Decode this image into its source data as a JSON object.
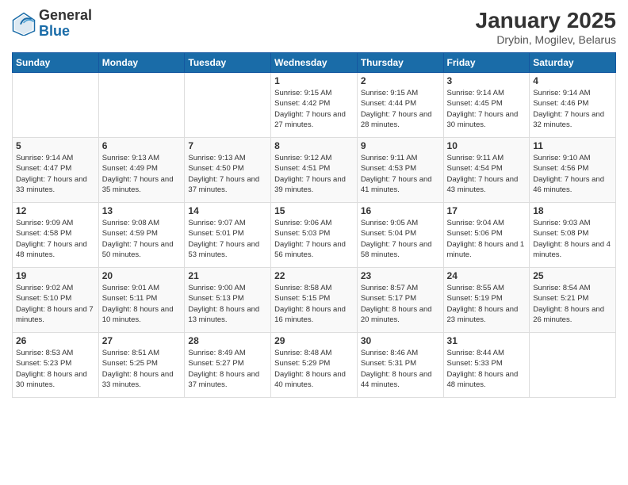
{
  "header": {
    "logo_general": "General",
    "logo_blue": "Blue",
    "main_title": "January 2025",
    "subtitle": "Drybin, Mogilev, Belarus"
  },
  "weekdays": [
    "Sunday",
    "Monday",
    "Tuesday",
    "Wednesday",
    "Thursday",
    "Friday",
    "Saturday"
  ],
  "weeks": [
    [
      {
        "day": "",
        "info": ""
      },
      {
        "day": "",
        "info": ""
      },
      {
        "day": "",
        "info": ""
      },
      {
        "day": "1",
        "info": "Sunrise: 9:15 AM\nSunset: 4:42 PM\nDaylight: 7 hours and 27 minutes."
      },
      {
        "day": "2",
        "info": "Sunrise: 9:15 AM\nSunset: 4:44 PM\nDaylight: 7 hours and 28 minutes."
      },
      {
        "day": "3",
        "info": "Sunrise: 9:14 AM\nSunset: 4:45 PM\nDaylight: 7 hours and 30 minutes."
      },
      {
        "day": "4",
        "info": "Sunrise: 9:14 AM\nSunset: 4:46 PM\nDaylight: 7 hours and 32 minutes."
      }
    ],
    [
      {
        "day": "5",
        "info": "Sunrise: 9:14 AM\nSunset: 4:47 PM\nDaylight: 7 hours and 33 minutes."
      },
      {
        "day": "6",
        "info": "Sunrise: 9:13 AM\nSunset: 4:49 PM\nDaylight: 7 hours and 35 minutes."
      },
      {
        "day": "7",
        "info": "Sunrise: 9:13 AM\nSunset: 4:50 PM\nDaylight: 7 hours and 37 minutes."
      },
      {
        "day": "8",
        "info": "Sunrise: 9:12 AM\nSunset: 4:51 PM\nDaylight: 7 hours and 39 minutes."
      },
      {
        "day": "9",
        "info": "Sunrise: 9:11 AM\nSunset: 4:53 PM\nDaylight: 7 hours and 41 minutes."
      },
      {
        "day": "10",
        "info": "Sunrise: 9:11 AM\nSunset: 4:54 PM\nDaylight: 7 hours and 43 minutes."
      },
      {
        "day": "11",
        "info": "Sunrise: 9:10 AM\nSunset: 4:56 PM\nDaylight: 7 hours and 46 minutes."
      }
    ],
    [
      {
        "day": "12",
        "info": "Sunrise: 9:09 AM\nSunset: 4:58 PM\nDaylight: 7 hours and 48 minutes."
      },
      {
        "day": "13",
        "info": "Sunrise: 9:08 AM\nSunset: 4:59 PM\nDaylight: 7 hours and 50 minutes."
      },
      {
        "day": "14",
        "info": "Sunrise: 9:07 AM\nSunset: 5:01 PM\nDaylight: 7 hours and 53 minutes."
      },
      {
        "day": "15",
        "info": "Sunrise: 9:06 AM\nSunset: 5:03 PM\nDaylight: 7 hours and 56 minutes."
      },
      {
        "day": "16",
        "info": "Sunrise: 9:05 AM\nSunset: 5:04 PM\nDaylight: 7 hours and 58 minutes."
      },
      {
        "day": "17",
        "info": "Sunrise: 9:04 AM\nSunset: 5:06 PM\nDaylight: 8 hours and 1 minute."
      },
      {
        "day": "18",
        "info": "Sunrise: 9:03 AM\nSunset: 5:08 PM\nDaylight: 8 hours and 4 minutes."
      }
    ],
    [
      {
        "day": "19",
        "info": "Sunrise: 9:02 AM\nSunset: 5:10 PM\nDaylight: 8 hours and 7 minutes."
      },
      {
        "day": "20",
        "info": "Sunrise: 9:01 AM\nSunset: 5:11 PM\nDaylight: 8 hours and 10 minutes."
      },
      {
        "day": "21",
        "info": "Sunrise: 9:00 AM\nSunset: 5:13 PM\nDaylight: 8 hours and 13 minutes."
      },
      {
        "day": "22",
        "info": "Sunrise: 8:58 AM\nSunset: 5:15 PM\nDaylight: 8 hours and 16 minutes."
      },
      {
        "day": "23",
        "info": "Sunrise: 8:57 AM\nSunset: 5:17 PM\nDaylight: 8 hours and 20 minutes."
      },
      {
        "day": "24",
        "info": "Sunrise: 8:55 AM\nSunset: 5:19 PM\nDaylight: 8 hours and 23 minutes."
      },
      {
        "day": "25",
        "info": "Sunrise: 8:54 AM\nSunset: 5:21 PM\nDaylight: 8 hours and 26 minutes."
      }
    ],
    [
      {
        "day": "26",
        "info": "Sunrise: 8:53 AM\nSunset: 5:23 PM\nDaylight: 8 hours and 30 minutes."
      },
      {
        "day": "27",
        "info": "Sunrise: 8:51 AM\nSunset: 5:25 PM\nDaylight: 8 hours and 33 minutes."
      },
      {
        "day": "28",
        "info": "Sunrise: 8:49 AM\nSunset: 5:27 PM\nDaylight: 8 hours and 37 minutes."
      },
      {
        "day": "29",
        "info": "Sunrise: 8:48 AM\nSunset: 5:29 PM\nDaylight: 8 hours and 40 minutes."
      },
      {
        "day": "30",
        "info": "Sunrise: 8:46 AM\nSunset: 5:31 PM\nDaylight: 8 hours and 44 minutes."
      },
      {
        "day": "31",
        "info": "Sunrise: 8:44 AM\nSunset: 5:33 PM\nDaylight: 8 hours and 48 minutes."
      },
      {
        "day": "",
        "info": ""
      }
    ]
  ]
}
